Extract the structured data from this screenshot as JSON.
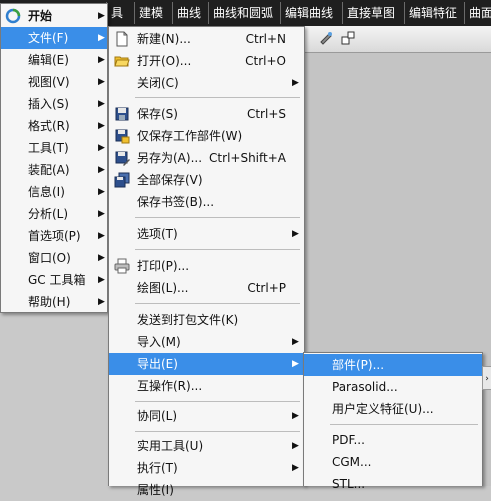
{
  "ribbon": {
    "tabs": [
      "具",
      "建模",
      "曲线",
      "曲线和圆弧",
      "编辑曲线",
      "直接草图",
      "编辑特征",
      "曲面"
    ]
  },
  "main_menu": {
    "items": [
      {
        "label": "开始"
      },
      {
        "label": "文件(F)"
      },
      {
        "label": "编辑(E)"
      },
      {
        "label": "视图(V)"
      },
      {
        "label": "插入(S)"
      },
      {
        "label": "格式(R)"
      },
      {
        "label": "工具(T)"
      },
      {
        "label": "装配(A)"
      },
      {
        "label": "信息(I)"
      },
      {
        "label": "分析(L)"
      },
      {
        "label": "首选项(P)"
      },
      {
        "label": "窗口(O)"
      },
      {
        "label": "GC 工具箱"
      },
      {
        "label": "帮助(H)"
      }
    ]
  },
  "file_menu": {
    "items": [
      {
        "label": "新建(N)...",
        "shortcut": "Ctrl+N"
      },
      {
        "label": "打开(O)...",
        "shortcut": "Ctrl+O"
      },
      {
        "label": "关闭(C)",
        "shortcut": ""
      },
      {
        "label": "保存(S)",
        "shortcut": "Ctrl+S"
      },
      {
        "label": "仅保存工作部件(W)",
        "shortcut": ""
      },
      {
        "label": "另存为(A)...",
        "shortcut": "Ctrl+Shift+A"
      },
      {
        "label": "全部保存(V)",
        "shortcut": ""
      },
      {
        "label": "保存书签(B)...",
        "shortcut": ""
      },
      {
        "label": "选项(T)",
        "shortcut": ""
      },
      {
        "label": "打印(P)...",
        "shortcut": ""
      },
      {
        "label": "绘图(L)...",
        "shortcut": "Ctrl+P"
      },
      {
        "label": "发送到打包文件(K)",
        "shortcut": ""
      },
      {
        "label": "导入(M)",
        "shortcut": ""
      },
      {
        "label": "导出(E)",
        "shortcut": ""
      },
      {
        "label": "互操作(R)...",
        "shortcut": ""
      },
      {
        "label": "协同(L)",
        "shortcut": ""
      },
      {
        "label": "实用工具(U)",
        "shortcut": ""
      },
      {
        "label": "执行(T)",
        "shortcut": ""
      },
      {
        "label": "属性(I)",
        "shortcut": ""
      }
    ]
  },
  "export_menu": {
    "items": [
      {
        "label": "部件(P)..."
      },
      {
        "label": "Parasolid..."
      },
      {
        "label": "用户定义特征(U)..."
      },
      {
        "label": "PDF..."
      },
      {
        "label": "CGM..."
      },
      {
        "label": "STL..."
      }
    ]
  },
  "colors": {
    "selection": "#3a8ee8",
    "ribbon_bg": "#1f1f1f",
    "menu_bg": "#f6f6f6"
  },
  "icons": [
    "nx-logo-icon",
    "new-file-icon",
    "open-folder-icon",
    "save-icon",
    "save-work-part-icon",
    "save-as-icon",
    "save-all-icon",
    "print-icon",
    "arrow-right-icon"
  ]
}
